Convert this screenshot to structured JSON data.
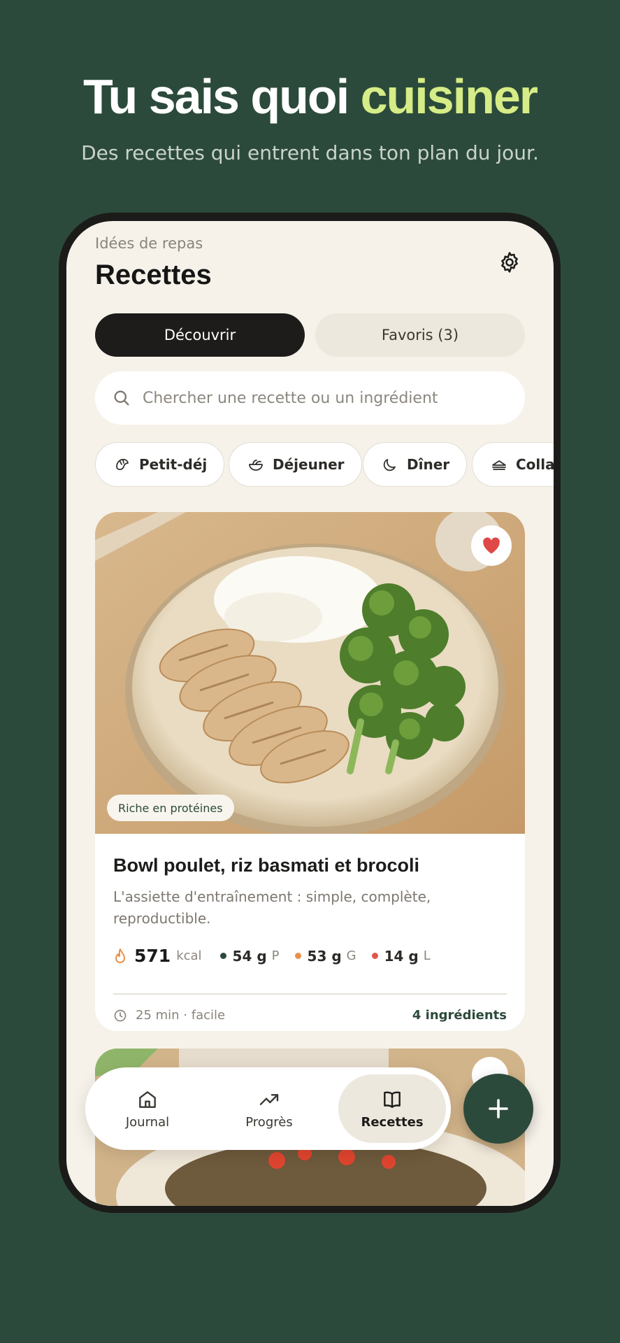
{
  "promo": {
    "headline_main": "Tu sais quoi",
    "headline_accent": "cuisiner",
    "subline": "Des recettes qui entrent dans ton plan du jour."
  },
  "header": {
    "eyebrow": "Idées de repas",
    "title": "Recettes",
    "settings_icon": "gear-icon"
  },
  "tabs": [
    {
      "label": "Découvrir",
      "active": true
    },
    {
      "label": "Favoris (3)",
      "active": false
    }
  ],
  "search": {
    "placeholder": "Chercher une recette ou un ingrédient",
    "value": ""
  },
  "categories": [
    {
      "label": "Petit-déj",
      "icon": "croissant-icon"
    },
    {
      "label": "Déjeuner",
      "icon": "salad-bowl-icon"
    },
    {
      "label": "Dîner",
      "icon": "moon-icon"
    },
    {
      "label": "Collation",
      "icon": "sandwich-icon"
    }
  ],
  "recipe": {
    "tag": "Riche en protéines",
    "favorite": true,
    "title": "Bowl poulet, riz basmati et brocoli",
    "description": "L'assiette d'entraînement : simple, complète, reproductible.",
    "kcal_value": "571",
    "kcal_unit": "kcal",
    "macros": [
      {
        "value": "54 g",
        "letter": "P",
        "color": "#2c4a3b"
      },
      {
        "value": "53 g",
        "letter": "G",
        "color": "#e8914a"
      },
      {
        "value": "14 g",
        "letter": "L",
        "color": "#e0564a"
      }
    ],
    "duration": "25 min · facile",
    "ingredients": "4 ingrédients"
  },
  "nav": {
    "items": [
      {
        "label": "Journal",
        "icon": "home-icon",
        "active": false
      },
      {
        "label": "Progrès",
        "icon": "trend-up-icon",
        "active": false
      },
      {
        "label": "Recettes",
        "icon": "book-icon",
        "active": true
      }
    ],
    "fab_icon": "plus-icon"
  },
  "colors": {
    "background": "#2c4a3b",
    "accent": "#d6ec86",
    "screen": "#f6f2ea",
    "favorite": "#e04848"
  }
}
